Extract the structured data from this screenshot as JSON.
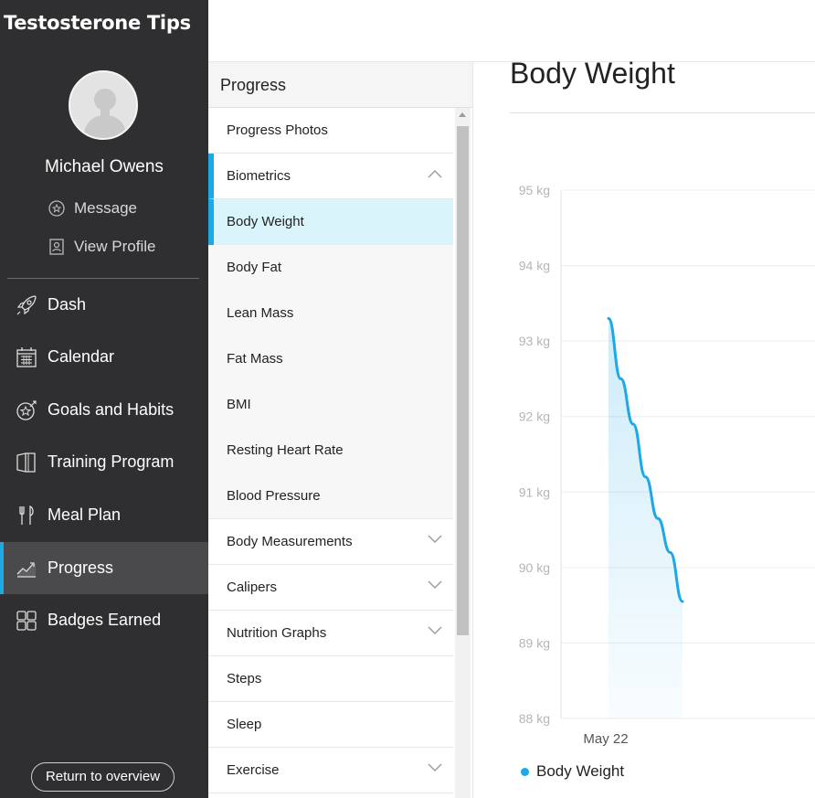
{
  "app": {
    "brand": "Testosterone Tips"
  },
  "user": {
    "name": "Michael Owens",
    "message_label": "Message",
    "profile_label": "View Profile"
  },
  "nav": {
    "dash": "Dash",
    "calendar": "Calendar",
    "goals": "Goals and Habits",
    "training": "Training Program",
    "meal": "Meal Plan",
    "progress": "Progress",
    "badges": "Badges Earned"
  },
  "return_label": "Return to overview",
  "submenu": {
    "title": "Progress",
    "items": [
      "Progress Photos",
      "Biometrics",
      "Body Weight",
      "Body Fat",
      "Lean Mass",
      "Fat Mass",
      "BMI",
      "Resting Heart Rate",
      "Blood Pressure",
      "Body Measurements",
      "Calipers",
      "Nutrition Graphs",
      "Steps",
      "Sleep",
      "Exercise"
    ]
  },
  "main": {
    "title": "Body Weight"
  },
  "colors": {
    "accent": "#1da8e6",
    "sidebar": "#2f2f31"
  },
  "chart_data": {
    "type": "area",
    "categories": [
      "May 22"
    ],
    "yticks": [
      "95 kg",
      "94 kg",
      "93 kg",
      "92 kg",
      "91 kg",
      "90 kg",
      "89 kg",
      "88 kg"
    ],
    "ylim": [
      88,
      95
    ],
    "series": [
      {
        "name": "Body Weight",
        "values": [
          93.3,
          92.5,
          91.9,
          91.2,
          90.65,
          90.2,
          89.55
        ]
      }
    ]
  }
}
